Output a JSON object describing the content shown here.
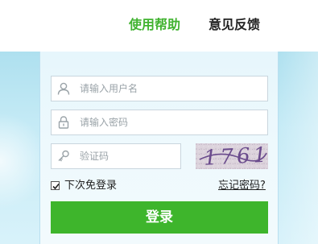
{
  "nav": {
    "help_label": "使用帮助",
    "feedback_label": "意见反馈"
  },
  "form": {
    "username_placeholder": "请输入用户名",
    "password_placeholder": "请输入密码",
    "captcha_placeholder": "验证码",
    "captcha_text": "1761",
    "remember_label": "下次免登录",
    "remember_checked": true,
    "forgot_label": "忘记密码?",
    "login_label": "登录"
  },
  "icons": {
    "username": "user-icon",
    "password": "lock-icon",
    "captcha": "key-icon"
  },
  "colors": {
    "accent_green": "#3eb52c",
    "nav_active": "#41b330",
    "background": "#c6ebf6"
  }
}
